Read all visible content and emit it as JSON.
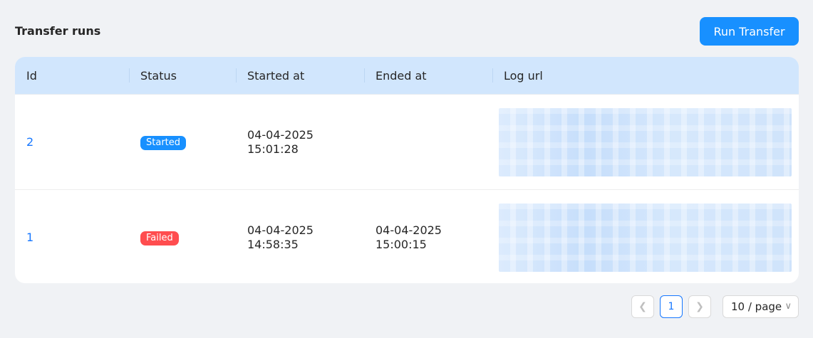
{
  "header": {
    "title": "Transfer runs",
    "run_button": "Run Transfer"
  },
  "table": {
    "columns": [
      "Id",
      "Status",
      "Started at",
      "Ended at",
      "Log url"
    ],
    "rows": [
      {
        "id": "2",
        "status": "Started",
        "started_date": "04-04-2025",
        "started_time": "15:01:28",
        "ended_date": "",
        "ended_time": ""
      },
      {
        "id": "1",
        "status": "Failed",
        "started_date": "04-04-2025",
        "started_time": "14:58:35",
        "ended_date": "04-04-2025",
        "ended_time": "15:00:15"
      }
    ]
  },
  "pagination": {
    "current_page": "1",
    "prev_icon": "chevron-left-icon",
    "next_icon": "chevron-right-icon",
    "page_size": "10 / page"
  },
  "colors": {
    "primary": "#1890ff",
    "started": "#1890ff",
    "failed": "#ff4d4f",
    "header_bg": "#d1e6fd"
  }
}
